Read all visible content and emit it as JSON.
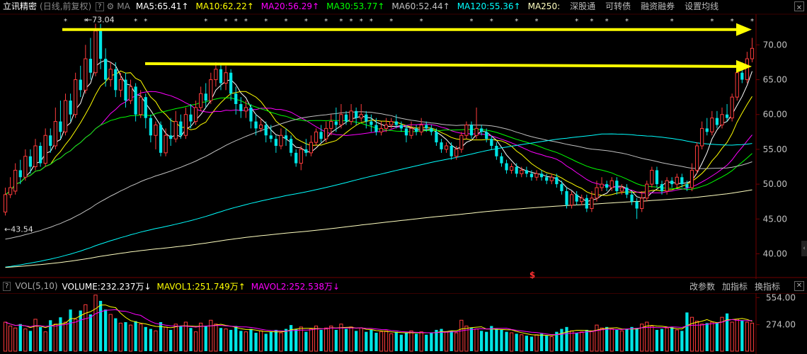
{
  "header": {
    "stock_name": "立讯精密",
    "period_info": "(日线,前复权)",
    "help": "?",
    "ma_label": "MA",
    "ma": [
      {
        "label": "MA5:65.41",
        "arrow": "↑",
        "color": "#ffffff"
      },
      {
        "label": "MA10:62.22",
        "arrow": "↑",
        "color": "#ffff00"
      },
      {
        "label": "MA20:56.29",
        "arrow": "↑",
        "color": "#ff00ff"
      },
      {
        "label": "MA30:53.77",
        "arrow": "↑",
        "color": "#00ff00"
      },
      {
        "label": "MA60:52.44",
        "arrow": "↑",
        "color": "#c0c0c0"
      },
      {
        "label": "MA120:55.36",
        "arrow": "↑",
        "color": "#00ffff"
      },
      {
        "label": "MA250:",
        "arrow": "",
        "color": "#ffffc0"
      }
    ],
    "menu": [
      "深股通",
      "可转债",
      "融资融券",
      "设置均线"
    ],
    "close": "✕"
  },
  "price_axis": [
    "70.00",
    "65.00",
    "60.00",
    "55.00",
    "50.00",
    "45.00",
    "40.00"
  ],
  "annotations": {
    "high": "73.04",
    "low": "43.54",
    "high_prefix": "←",
    "low_prefix": "←"
  },
  "volume_header": {
    "help": "?",
    "name": "VOL(5,10)",
    "items": [
      {
        "label": "VOLUME:232.237万",
        "arrow": "↓",
        "color": "#ffffff"
      },
      {
        "label": "MAVOL1:251.749万",
        "arrow": "↑",
        "color": "#ffff00"
      },
      {
        "label": "MAVOL2:252.538万",
        "arrow": "↓",
        "color": "#ff00ff"
      }
    ],
    "menu": [
      "改参数",
      "加指标",
      "换指标"
    ],
    "close": "✕"
  },
  "volume_axis": [
    "554.00",
    "274.00"
  ],
  "chart_data": {
    "type": "candlestick",
    "y_range": [
      37,
      74
    ],
    "volume_range": [
      0,
      600
    ],
    "marker": "$",
    "arrows": [
      {
        "label": "",
        "from_price": 72.2,
        "to_price": 72.2
      },
      {
        "label": "",
        "from_price": 67.3,
        "to_price": 66.9
      }
    ],
    "candles": [
      [
        46,
        48.5,
        45.5,
        49.5
      ],
      [
        48.5,
        49.5,
        48,
        51
      ],
      [
        49,
        52,
        48.5,
        53
      ],
      [
        52,
        51,
        50,
        53.5
      ],
      [
        51,
        54,
        50.5,
        55
      ],
      [
        54,
        52.5,
        51.5,
        55
      ],
      [
        52.5,
        55.5,
        52,
        56.5
      ],
      [
        55.5,
        53,
        52.5,
        56
      ],
      [
        53,
        57,
        52.5,
        58
      ],
      [
        57,
        55.5,
        54.5,
        58
      ],
      [
        55.5,
        59,
        55,
        61
      ],
      [
        59,
        57.5,
        56.5,
        62
      ],
      [
        57.5,
        62,
        57,
        63
      ],
      [
        62,
        60,
        59,
        63
      ],
      [
        60,
        65,
        59.5,
        66
      ],
      [
        65,
        63.5,
        62.5,
        67
      ],
      [
        63.5,
        68,
        63,
        70
      ],
      [
        68,
        66,
        65,
        71
      ],
      [
        66,
        72,
        65.5,
        73.04
      ],
      [
        72,
        68,
        66.5,
        73
      ],
      [
        68,
        65,
        64,
        69.5
      ],
      [
        65,
        66.5,
        64,
        67.5
      ],
      [
        66.5,
        63.5,
        62.5,
        67.5
      ],
      [
        63.5,
        65,
        62.5,
        66
      ],
      [
        65,
        62,
        61,
        66
      ],
      [
        62,
        64,
        61.5,
        65
      ],
      [
        64,
        60,
        59,
        64.5
      ],
      [
        60,
        62.5,
        59.5,
        63.5
      ],
      [
        62.5,
        59.5,
        58,
        63
      ],
      [
        59.5,
        57,
        56,
        60
      ],
      [
        57,
        58.5,
        55,
        59
      ],
      [
        58.5,
        54.5,
        54,
        59
      ],
      [
        54.5,
        57,
        54,
        58
      ],
      [
        57,
        56.5,
        55.5,
        59.5
      ],
      [
        56.5,
        59,
        56,
        60.5
      ],
      [
        59,
        57,
        56.5,
        60
      ],
      [
        57,
        60,
        56.5,
        61
      ],
      [
        60,
        59,
        58,
        61.5
      ],
      [
        59,
        61,
        58.5,
        62
      ],
      [
        61,
        63,
        60.5,
        64
      ],
      [
        63,
        62,
        61,
        64.5
      ],
      [
        62,
        65,
        61.5,
        66
      ],
      [
        65,
        66.5,
        64,
        67.5
      ],
      [
        66.5,
        64.5,
        63.5,
        67.3
      ],
      [
        64.5,
        66,
        63.5,
        67
      ],
      [
        66,
        63,
        62,
        66.5
      ],
      [
        63,
        61.5,
        60,
        64
      ],
      [
        61.5,
        60.5,
        59.5,
        62.5
      ],
      [
        60.5,
        61,
        59.5,
        62
      ],
      [
        61,
        59,
        58,
        61.5
      ],
      [
        59,
        58,
        57,
        60
      ],
      [
        58,
        58.5,
        57.5,
        59.5
      ],
      [
        58.5,
        57,
        56,
        59
      ],
      [
        57,
        56.5,
        56,
        58.5
      ],
      [
        56.5,
        55.5,
        54.5,
        57
      ],
      [
        55.5,
        57,
        55,
        58
      ],
      [
        57,
        56.5,
        55.5,
        58
      ],
      [
        56.5,
        54.5,
        54,
        57
      ],
      [
        54.5,
        53,
        52.5,
        55
      ],
      [
        53,
        55,
        52,
        55.5
      ],
      [
        55,
        54.5,
        54,
        56.5
      ],
      [
        54.5,
        56,
        54,
        57
      ],
      [
        56,
        57.5,
        55.5,
        58
      ],
      [
        57.5,
        56.5,
        56,
        58.5
      ],
      [
        56.5,
        58,
        56,
        59
      ],
      [
        58,
        59,
        57,
        60
      ],
      [
        59,
        58.5,
        57.5,
        61
      ],
      [
        58.5,
        60,
        58,
        61.5
      ],
      [
        60,
        59,
        58.5,
        60.5
      ],
      [
        59,
        60.5,
        58.5,
        61.5
      ],
      [
        60.5,
        59.5,
        58.5,
        61
      ],
      [
        59.5,
        60,
        59,
        61.5
      ],
      [
        60,
        59,
        58,
        60.5
      ],
      [
        59,
        58.5,
        57.5,
        60
      ],
      [
        58.5,
        57.5,
        57,
        59.5
      ],
      [
        57.5,
        58,
        57,
        59
      ],
      [
        58,
        58.5,
        57.5,
        59.5
      ],
      [
        58.5,
        59,
        58,
        59.5
      ],
      [
        59,
        58.5,
        58,
        60
      ],
      [
        58.5,
        58,
        57.5,
        59
      ],
      [
        58,
        57,
        56,
        58.5
      ],
      [
        57,
        58,
        56.5,
        59
      ],
      [
        58,
        57.5,
        57,
        58.5
      ],
      [
        57.5,
        58.5,
        57,
        59.5
      ],
      [
        58.5,
        58,
        57.5,
        59
      ],
      [
        58,
        57.5,
        57,
        58.5
      ],
      [
        57.5,
        56,
        55.5,
        58
      ],
      [
        56,
        55,
        54.5,
        56.5
      ],
      [
        55,
        55.5,
        54.5,
        56
      ],
      [
        55.5,
        54,
        53.5,
        56
      ],
      [
        54,
        55,
        53.5,
        55.5
      ],
      [
        55,
        57,
        54.5,
        57.5
      ],
      [
        57,
        58.5,
        56.5,
        59
      ],
      [
        58.5,
        57,
        56.5,
        59
      ],
      [
        57,
        58,
        56.5,
        61
      ],
      [
        58,
        57.5,
        57,
        58.5
      ],
      [
        57.5,
        56.5,
        56,
        58
      ],
      [
        56.5,
        55.5,
        55,
        57
      ],
      [
        55.5,
        54,
        53.5,
        56
      ],
      [
        54,
        53,
        52.5,
        54.5
      ],
      [
        53,
        52,
        51.5,
        53.5
      ],
      [
        52,
        52.5,
        51.5,
        53
      ],
      [
        52.5,
        51.5,
        51,
        53
      ],
      [
        51.5,
        52,
        51,
        52.5
      ],
      [
        52,
        51.5,
        51,
        52.5
      ],
      [
        51.5,
        51,
        50.5,
        52
      ],
      [
        51,
        51.5,
        50.5,
        52
      ],
      [
        51.5,
        51,
        50.5,
        52
      ],
      [
        51,
        50.5,
        50,
        51.5
      ],
      [
        50.5,
        51,
        50,
        51.5
      ],
      [
        51,
        50,
        49.5,
        51.5
      ],
      [
        50,
        49,
        48.5,
        50.5
      ],
      [
        49,
        47,
        46.5,
        49.5
      ],
      [
        47,
        48.5,
        46.5,
        49
      ],
      [
        48.5,
        47.5,
        47,
        49
      ],
      [
        47.5,
        48,
        47,
        48.5
      ],
      [
        48,
        46.5,
        46,
        48.5
      ],
      [
        46.5,
        48,
        46,
        49
      ],
      [
        48,
        49.5,
        47.5,
        50.5
      ],
      [
        49.5,
        50,
        49,
        51
      ],
      [
        50,
        49.5,
        49,
        50.5
      ],
      [
        49.5,
        50.5,
        49,
        51
      ],
      [
        50.5,
        49,
        48.5,
        51
      ],
      [
        49,
        49.5,
        48.5,
        50
      ],
      [
        49.5,
        48.5,
        48,
        50
      ],
      [
        48.5,
        47.5,
        47,
        49
      ],
      [
        47.5,
        46.5,
        45,
        48
      ],
      [
        46.5,
        48,
        46,
        49
      ],
      [
        48,
        50,
        47.5,
        50.5
      ],
      [
        50,
        52,
        49.5,
        52.5
      ],
      [
        52,
        50,
        49.5,
        52.5
      ],
      [
        50,
        49,
        48.5,
        50.5
      ],
      [
        49,
        50.5,
        48.5,
        51
      ],
      [
        50.5,
        50,
        49.5,
        51
      ],
      [
        50,
        51,
        49.5,
        51.5
      ],
      [
        51,
        50,
        49.5,
        51.5
      ],
      [
        50,
        49.5,
        49,
        50.5
      ],
      [
        49.5,
        52,
        49,
        53
      ],
      [
        52,
        55.5,
        51.5,
        56
      ],
      [
        55.5,
        58,
        55,
        59
      ],
      [
        58,
        57.5,
        57,
        59.5
      ],
      [
        57.5,
        59.5,
        57,
        60.5
      ],
      [
        59.5,
        58.5,
        58,
        60.5
      ],
      [
        58.5,
        60,
        58,
        61
      ],
      [
        60,
        59.5,
        59,
        61.5
      ],
      [
        59.5,
        62.5,
        59,
        63
      ],
      [
        62.5,
        66,
        62,
        67
      ],
      [
        66,
        65,
        64.5,
        67.5
      ],
      [
        65,
        68,
        64.5,
        69
      ],
      [
        68,
        69.5,
        67.5,
        71
      ]
    ],
    "volume": [
      300,
      260,
      240,
      280,
      230,
      210,
      330,
      250,
      200,
      320,
      280,
      350,
      300,
      430,
      330,
      420,
      480,
      380,
      580,
      520,
      430,
      380,
      340,
      290,
      300,
      270,
      310,
      280,
      250,
      230,
      210,
      300,
      250,
      220,
      280,
      260,
      300,
      240,
      200,
      290,
      260,
      320,
      280,
      240,
      230,
      220,
      260,
      210,
      200,
      230,
      190,
      210,
      180,
      200,
      220,
      190,
      230,
      270,
      230,
      250,
      200,
      230,
      260,
      220,
      240,
      260,
      220,
      280,
      230,
      250,
      210,
      240,
      200,
      220,
      190,
      200,
      210,
      180,
      200,
      170,
      190,
      210,
      180,
      200,
      170,
      190,
      220,
      230,
      200,
      210,
      190,
      320,
      260,
      240,
      230,
      210,
      200,
      260,
      230,
      220,
      200,
      190,
      180,
      170,
      160,
      150,
      170,
      180,
      160,
      150,
      200,
      230,
      250,
      210,
      190,
      200,
      220,
      210,
      270,
      240,
      250,
      230,
      220,
      210,
      230,
      250,
      240,
      280,
      300,
      260,
      220,
      230,
      240,
      250,
      220,
      210,
      400,
      350,
      310,
      280,
      290,
      300,
      290,
      350,
      390,
      300,
      330,
      320,
      300,
      290
    ]
  }
}
